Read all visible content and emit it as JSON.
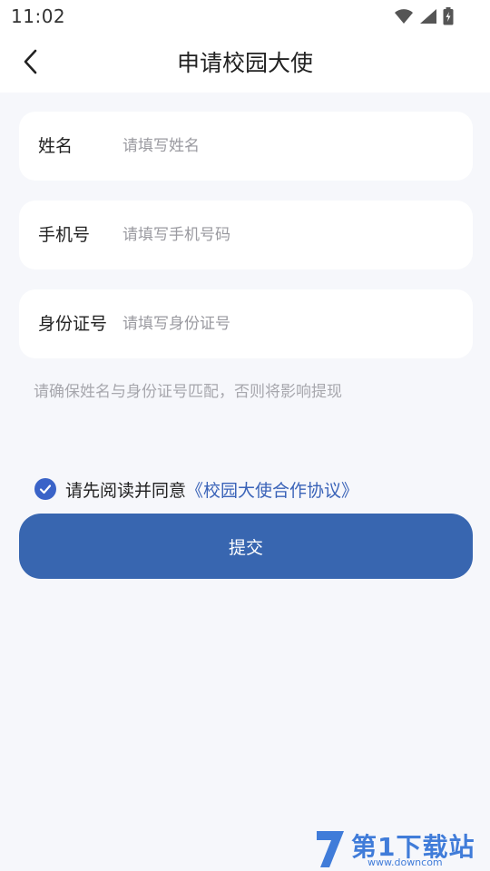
{
  "status_bar": {
    "time": "11:02"
  },
  "nav": {
    "title": "申请校园大使"
  },
  "form": {
    "fields": [
      {
        "label": "姓名",
        "placeholder": "请填写姓名",
        "value": ""
      },
      {
        "label": "手机号",
        "placeholder": "请填写手机号码",
        "value": ""
      },
      {
        "label": "身份证号",
        "placeholder": "请填写身份证号",
        "value": ""
      }
    ],
    "hint": "请确保姓名与身份证号匹配，否则将影响提现"
  },
  "agreement": {
    "checked": true,
    "text": "请先阅读并同意",
    "link": "《校园大使合作协议》"
  },
  "submit": {
    "label": "提交"
  },
  "watermark": {
    "text": "第1下载站",
    "url": "www.downcom"
  },
  "colors": {
    "primary": "#3866b0",
    "checkbox": "#3a63c8",
    "link": "#3a63b8",
    "background": "#f6f7fb"
  }
}
